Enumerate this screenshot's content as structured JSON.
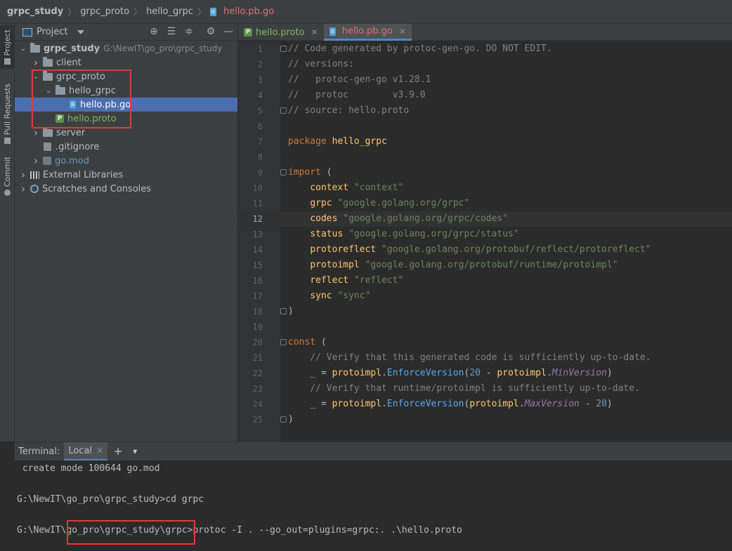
{
  "breadcrumb": [
    "grpc_study",
    "grpc_proto",
    "hello_grpc",
    "hello.pb.go"
  ],
  "side_strip": [
    "Project",
    "Pull Requests",
    "Commit"
  ],
  "project_panel": {
    "title": "Project",
    "tools": [
      "locate-icon",
      "expand-all-icon",
      "collapse-all-icon",
      "gear-icon",
      "minimize-icon"
    ],
    "tree": [
      {
        "label": "grpc_study",
        "path": "G:\\NewIT\\go_pro\\grpc_study",
        "indent": 0,
        "arrow": "down",
        "icon": "folder",
        "style": "bold"
      },
      {
        "label": "client",
        "indent": 1,
        "arrow": "right",
        "icon": "folder"
      },
      {
        "label": "grpc_proto",
        "indent": 1,
        "arrow": "down",
        "icon": "folder"
      },
      {
        "label": "hello_grpc",
        "indent": 2,
        "arrow": "down",
        "icon": "folder"
      },
      {
        "label": "hello.pb.go",
        "indent": 3,
        "arrow": "",
        "icon": "go-file",
        "selected": true,
        "style": "white"
      },
      {
        "label": "hello.proto",
        "indent": 2,
        "arrow": "",
        "icon": "proto-file",
        "style": "green"
      },
      {
        "label": "server",
        "indent": 1,
        "arrow": "right",
        "icon": "folder"
      },
      {
        "label": ".gitignore",
        "indent": 1,
        "arrow": "",
        "icon": "git-file"
      },
      {
        "label": "go.mod",
        "indent": 1,
        "arrow": "right",
        "icon": "mod-file",
        "style": "blue"
      },
      {
        "label": "External Libraries",
        "indent": 0,
        "arrow": "right",
        "icon": "library"
      },
      {
        "label": "Scratches and Consoles",
        "indent": 0,
        "arrow": "right",
        "icon": "scratch"
      }
    ]
  },
  "editor": {
    "tabs": [
      {
        "label": "hello.proto",
        "icon": "proto",
        "active": false
      },
      {
        "label": "hello.pb.go",
        "icon": "go",
        "active": true
      }
    ],
    "current_line": 12,
    "lines": [
      {
        "n": "1",
        "fold": true,
        "tokens": [
          [
            "cm",
            "// Code generated by protoc-gen-go. DO NOT EDIT."
          ]
        ]
      },
      {
        "n": "2",
        "tokens": [
          [
            "cm",
            "// versions:"
          ]
        ]
      },
      {
        "n": "3",
        "tokens": [
          [
            "cm",
            "// \tprotoc-gen-go v1.28.1"
          ]
        ]
      },
      {
        "n": "4",
        "tokens": [
          [
            "cm",
            "// \tprotoc        v3.9.0"
          ]
        ]
      },
      {
        "n": "5",
        "fold": true,
        "tokens": [
          [
            "cm",
            "// source: hello.proto"
          ]
        ]
      },
      {
        "n": "6",
        "tokens": []
      },
      {
        "n": "7",
        "tokens": [
          [
            "kw",
            "package "
          ],
          [
            "pk",
            "hello_grpc"
          ]
        ]
      },
      {
        "n": "8",
        "tokens": []
      },
      {
        "n": "9",
        "fold": true,
        "tokens": [
          [
            "kw",
            "import "
          ],
          [
            "id",
            "("
          ]
        ]
      },
      {
        "n": "10",
        "tokens": [
          [
            "id",
            "    "
          ],
          [
            "pk",
            "context "
          ],
          [
            "str",
            "\"context\""
          ]
        ]
      },
      {
        "n": "11",
        "tokens": [
          [
            "id",
            "    "
          ],
          [
            "pk",
            "grpc "
          ],
          [
            "str",
            "\"google.golang.org/grpc\""
          ]
        ]
      },
      {
        "n": "12",
        "tokens": [
          [
            "id",
            "    "
          ],
          [
            "pk",
            "codes "
          ],
          [
            "str",
            "\"google.golang.org/grpc/codes\""
          ]
        ]
      },
      {
        "n": "13",
        "tokens": [
          [
            "id",
            "    "
          ],
          [
            "pk",
            "status "
          ],
          [
            "str",
            "\"google.golang.org/grpc/status\""
          ]
        ]
      },
      {
        "n": "14",
        "tokens": [
          [
            "id",
            "    "
          ],
          [
            "pk",
            "protoreflect "
          ],
          [
            "str",
            "\"google.golang.org/protobuf/reflect/protoreflect\""
          ]
        ]
      },
      {
        "n": "15",
        "tokens": [
          [
            "id",
            "    "
          ],
          [
            "pk",
            "protoimpl "
          ],
          [
            "str",
            "\"google.golang.org/protobuf/runtime/protoimpl\""
          ]
        ]
      },
      {
        "n": "16",
        "tokens": [
          [
            "id",
            "    "
          ],
          [
            "pk",
            "reflect "
          ],
          [
            "str",
            "\"reflect\""
          ]
        ]
      },
      {
        "n": "17",
        "tokens": [
          [
            "id",
            "    "
          ],
          [
            "pk",
            "sync "
          ],
          [
            "str",
            "\"sync\""
          ]
        ]
      },
      {
        "n": "18",
        "fold": true,
        "tokens": [
          [
            "id",
            ")"
          ]
        ]
      },
      {
        "n": "19",
        "tokens": []
      },
      {
        "n": "20",
        "fold": true,
        "tokens": [
          [
            "kw",
            "const "
          ],
          [
            "id",
            "("
          ]
        ]
      },
      {
        "n": "21",
        "tokens": [
          [
            "id",
            "    "
          ],
          [
            "cm",
            "// Verify that this generated code is sufficiently up-to-date."
          ]
        ]
      },
      {
        "n": "22",
        "tokens": [
          [
            "id",
            "    _ = "
          ],
          [
            "pk",
            "protoimpl"
          ],
          [
            "id",
            "."
          ],
          [
            "call",
            "EnforceVersion"
          ],
          [
            "id",
            "("
          ],
          [
            "num",
            "20"
          ],
          [
            "id",
            " - "
          ],
          [
            "pk",
            "protoimpl"
          ],
          [
            "id",
            "."
          ],
          [
            "it",
            "MinVersion"
          ],
          [
            "id",
            ")"
          ]
        ]
      },
      {
        "n": "23",
        "tokens": [
          [
            "id",
            "    "
          ],
          [
            "cm",
            "// Verify that runtime/protoimpl is sufficiently up-to-date."
          ]
        ]
      },
      {
        "n": "24",
        "tokens": [
          [
            "id",
            "    _ = "
          ],
          [
            "pk",
            "protoimpl"
          ],
          [
            "id",
            "."
          ],
          [
            "call",
            "EnforceVersion"
          ],
          [
            "id",
            "("
          ],
          [
            "pk",
            "protoimpl"
          ],
          [
            "id",
            "."
          ],
          [
            "it",
            "MaxVersion"
          ],
          [
            "id",
            " - "
          ],
          [
            "num",
            "20"
          ],
          [
            "id",
            ")"
          ]
        ]
      },
      {
        "n": "25",
        "fold": true,
        "tokens": [
          [
            "id",
            ")"
          ]
        ]
      }
    ]
  },
  "terminal": {
    "label": "Terminal:",
    "tab": "Local",
    "lines": [
      " create mode 100644 go.mod",
      "",
      "G:\\NewIT\\go_pro\\grpc_study>cd grpc",
      "",
      "G:\\NewIT\\go_pro\\grpc_study\\grpc>protoc -I . --go_out=plugins=grpc:. .\\hello.proto"
    ]
  },
  "colors": {
    "highlight_box": "#e53935",
    "selection": "#4b6eaf"
  }
}
